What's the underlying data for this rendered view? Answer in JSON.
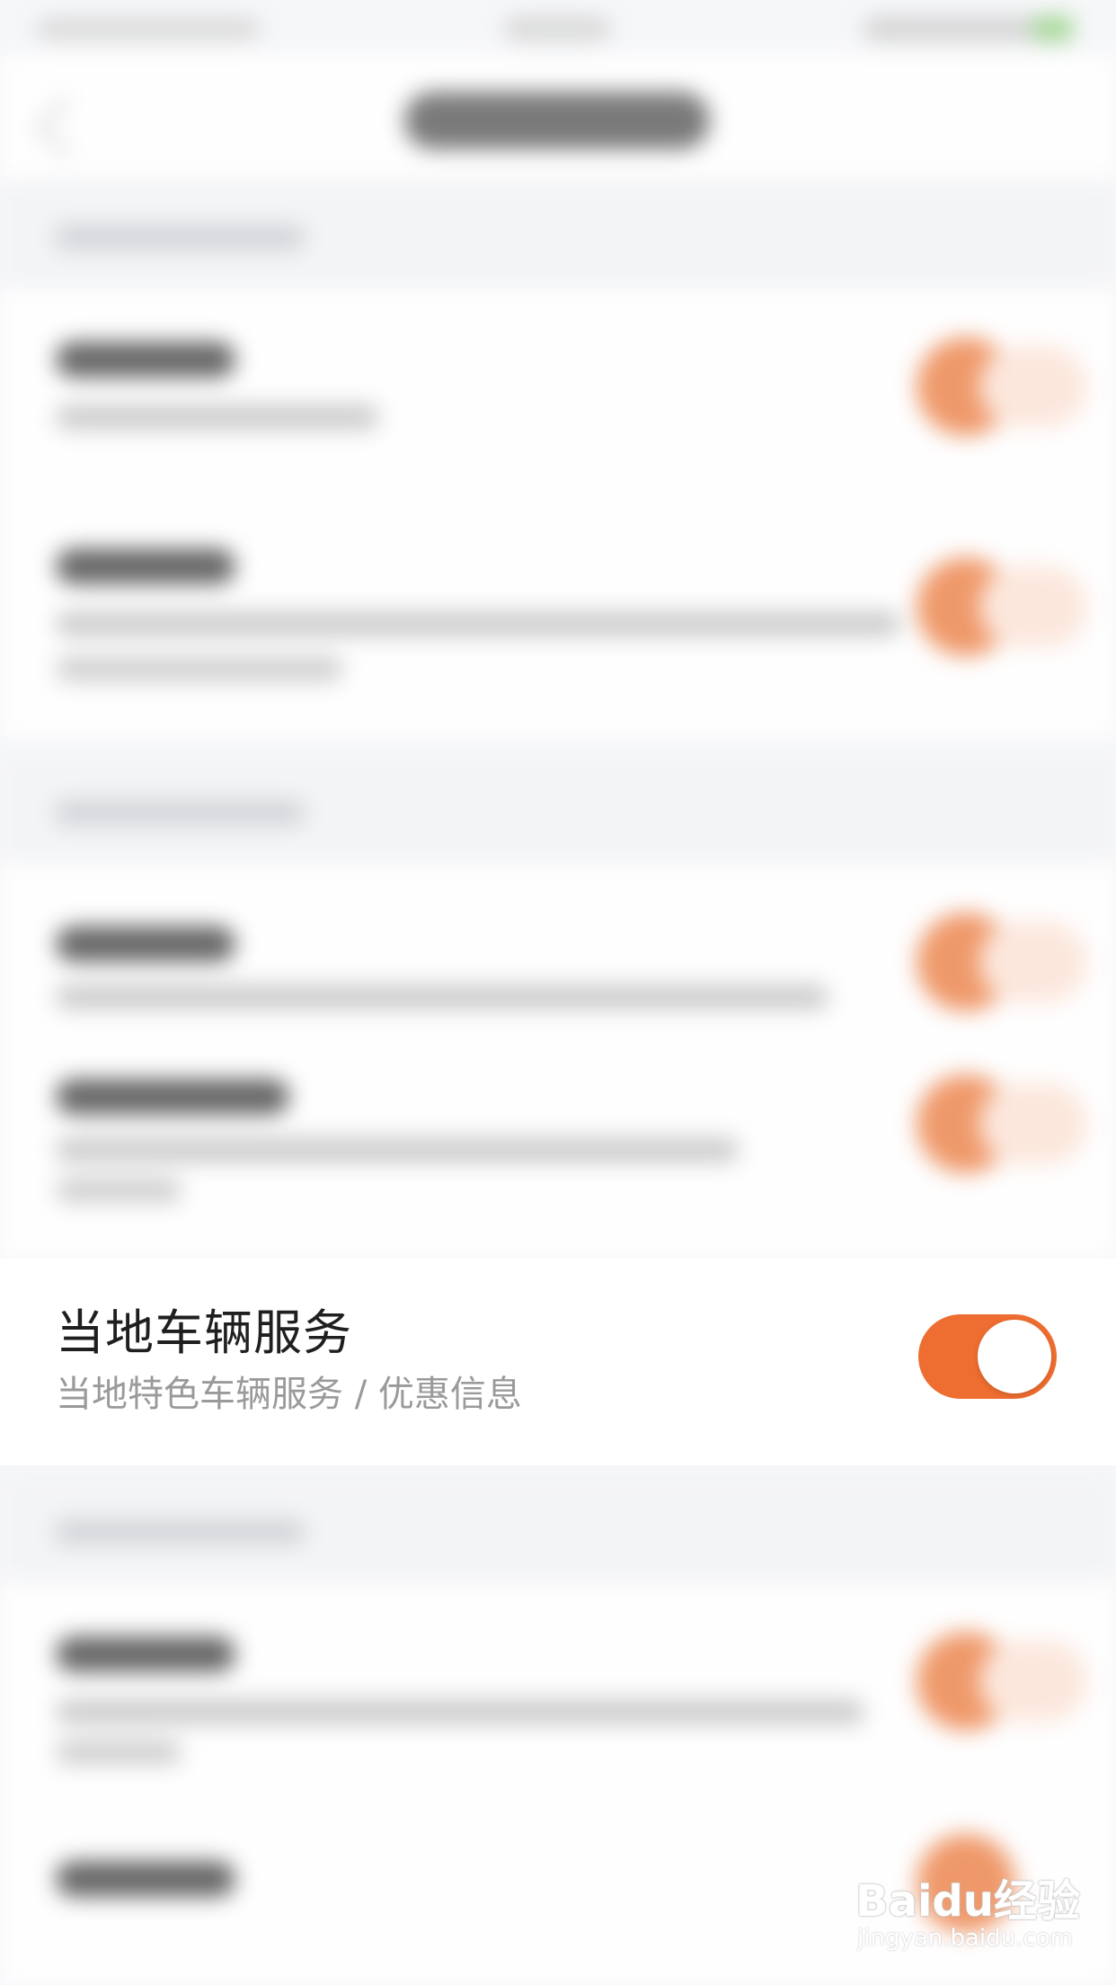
{
  "row": {
    "title": "当地车辆服务",
    "subtitle": "当地特色车辆服务 / 优惠信息",
    "toggle_on": true
  },
  "colors": {
    "accent": "#ee6d30",
    "title": "#1f1f1f",
    "subtitle": "#9a9a9a",
    "background": "#f6f7f9"
  },
  "watermark": {
    "main": "Baidu经验",
    "sub": "jingyan.baidu.com"
  }
}
